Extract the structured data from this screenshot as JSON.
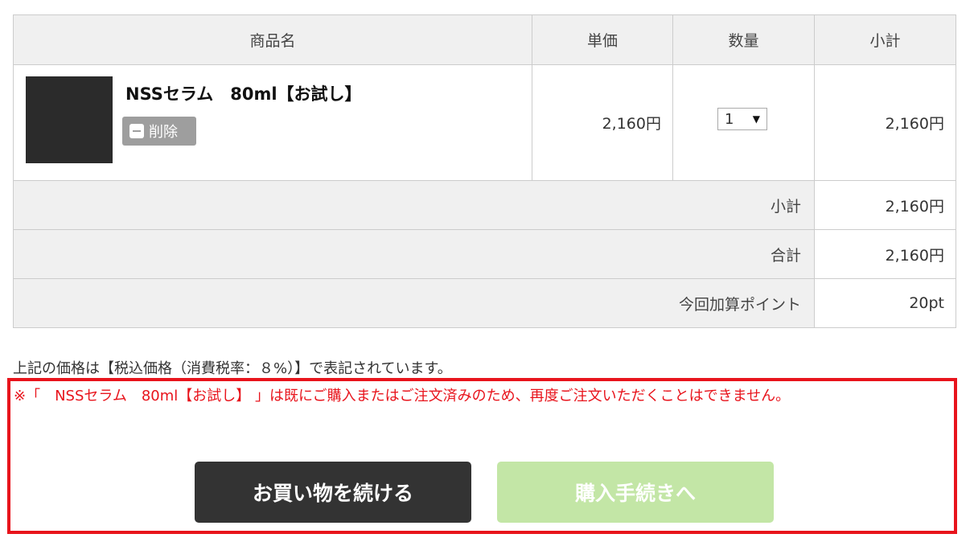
{
  "table": {
    "headers": {
      "product": "商品名",
      "unit_price": "単価",
      "quantity": "数量",
      "subtotal": "小計"
    },
    "item": {
      "name": "NSSセラム　80ml【お試し】",
      "delete_label": "削除",
      "unit_price": "2,160円",
      "quantity": "1",
      "subtotal": "2,160円"
    },
    "summary": [
      {
        "label": "小計",
        "value": "2,160円"
      },
      {
        "label": "合計",
        "value": "2,160円"
      },
      {
        "label": "今回加算ポイント",
        "value": "20pt"
      }
    ]
  },
  "tax_note": "上記の価格は【税込価格（消費税率：８%）】で表記されています。",
  "warning": "※「　NSSセラム　80ml【お試し】 」は既にご購入またはご注文済みのため、再度ご注文いただくことはできません。",
  "buttons": {
    "continue_shopping": "お買い物を続ける",
    "checkout": "購入手続きへ"
  },
  "colors": {
    "warning_red": "#e8141c",
    "checkout_disabled": "#c3e6a6",
    "continue_dark": "#333333",
    "table_header_bg": "#f0f0f0"
  },
  "icons": {
    "delete": "minus-icon",
    "quantity_dropdown": "caret-down-icon"
  }
}
